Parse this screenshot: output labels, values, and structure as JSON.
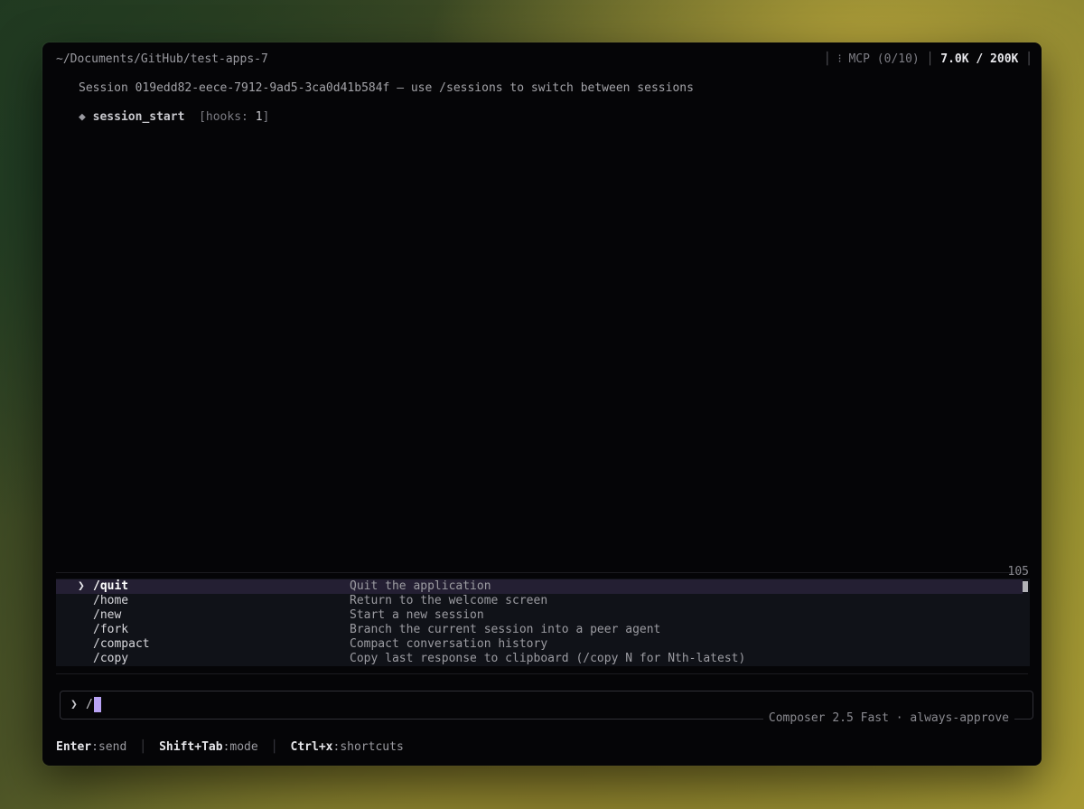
{
  "header": {
    "cwd": "~/Documents/GitHub/test-apps-7",
    "mcp": "MCP (0/10)",
    "tokens": "7.0K / 200K"
  },
  "session": {
    "line": "Session 019edd82-eece-7912-9ad5-3ca0d41b584f — use /sessions to switch between sessions",
    "hook_name": "session_start",
    "hook_meta_prefix": "[hooks: ",
    "hook_count": "1",
    "hook_meta_suffix": "]"
  },
  "command_menu": {
    "count": "105",
    "items": [
      {
        "command": "/quit",
        "description": "Quit the application",
        "selected": true
      },
      {
        "command": "/home",
        "description": "Return to the welcome screen"
      },
      {
        "command": "/new",
        "description": "Start a new session"
      },
      {
        "command": "/fork",
        "description": "Branch the current session into a peer agent"
      },
      {
        "command": "/compact",
        "description": "Compact conversation history"
      },
      {
        "command": "/copy",
        "description": "Copy last response to clipboard (/copy N for Nth-latest)"
      }
    ]
  },
  "input": {
    "prompt": "❯",
    "value": "/",
    "status": "Composer 2.5 Fast · always-approve"
  },
  "footer": {
    "items": [
      {
        "key": "Enter",
        "action": ":send"
      },
      {
        "key": "Shift+Tab",
        "action": ":mode"
      },
      {
        "key": "Ctrl+x",
        "action": ":shortcuts"
      }
    ]
  },
  "colors": {
    "window_bg": "#050507",
    "selection_bg": "#241f33",
    "cursor": "#b9a3f5"
  }
}
